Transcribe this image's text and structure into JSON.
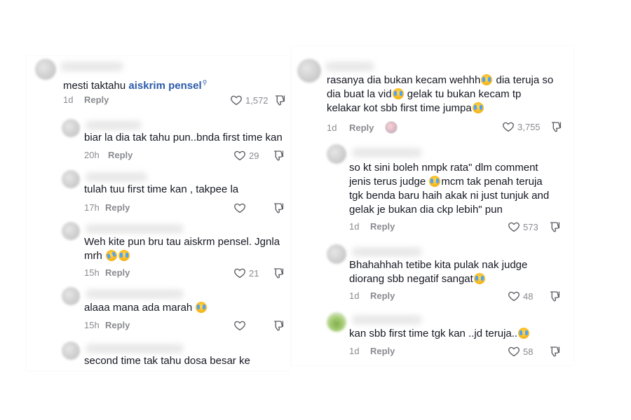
{
  "left_column": {
    "comments": [
      {
        "text_before": "mesti taktahu ",
        "link": "aiskrim pensel",
        "time": "1d",
        "reply": "Reply",
        "likes": "1,572"
      },
      {
        "text": "biar la dia tak tahu pun..bnda first time kan",
        "time": "20h",
        "reply": "Reply",
        "likes": "29"
      },
      {
        "text": "tulah tuu first time kan , takpee la",
        "time": "17h",
        "reply": "Reply",
        "likes": ""
      },
      {
        "text_line1": "Weh kite pun bru tau aiskrm pensel. Jgnla",
        "text_line2": "mrh",
        "time": "15h",
        "reply": "Reply",
        "likes": "21"
      },
      {
        "text": "alaaa mana ada marah",
        "time": "15h",
        "reply": "Reply",
        "likes": ""
      },
      {
        "text": "second time tak tahu dosa besar ke"
      }
    ]
  },
  "right_column": {
    "comments": [
      {
        "line1a": "rasanya dia bukan kecam wehhh",
        "line1b": " dia teruja so",
        "line2a": "dia buat la vid",
        "line2b": " gelak tu bukan kecam tp",
        "line3": "kelakar kot sbb first time jumpa",
        "time": "1d",
        "reply": "Reply",
        "likes": "3,755"
      },
      {
        "line1": "so kt sini boleh nmpk rata\" dlm comment",
        "line2a": "jenis terus judge ",
        "line2b": "mcm tak penah teruja",
        "line3": "tgk benda baru haih akak ni just tunjuk and",
        "line4": "gelak je bukan dia ckp lebih\" pun",
        "time": "1d",
        "reply": "Reply",
        "likes": "573"
      },
      {
        "line1": "Bhahahhah tetibe kita pulak nak judge",
        "line2": "diorang sbb negatif sangat",
        "time": "1d",
        "reply": "Reply",
        "likes": "48"
      },
      {
        "line1": "kan sbb first time tgk kan ..jd teruja..",
        "time": "1d",
        "reply": "Reply",
        "likes": "58"
      }
    ]
  },
  "icons": {
    "like": "heart-outline-icon",
    "dislike": "thumbs-down-icon",
    "emoji": "loudly-crying-face-emoji"
  },
  "colors": {
    "text": "#161823",
    "meta": "#8a8b91",
    "link": "#2b5ba8"
  }
}
